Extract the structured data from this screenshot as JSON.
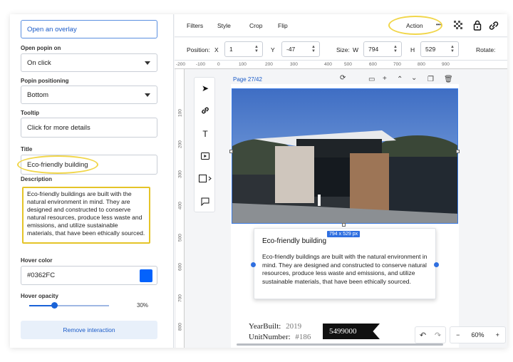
{
  "left_panel": {
    "overlay_button": "Open an overlay",
    "popin_on": {
      "label": "Open popin on",
      "value": "On click"
    },
    "popin_positioning": {
      "label": "Popin positioning",
      "value": "Bottom"
    },
    "tooltip": {
      "label": "Tooltip",
      "value": "Click for more details"
    },
    "title": {
      "label": "Title",
      "value": "Eco-friendly building"
    },
    "description": {
      "label": "Description",
      "value": "Eco-friendly buildings are built with the natural environment in mind. They are designed and constructed to conserve natural resources, produce less waste and emissions, and utilize sustainable materials, that have been ethically sourced."
    },
    "hover_color": {
      "label": "Hover color",
      "value": "#0362FC",
      "swatch": "#0362FC"
    },
    "hover_opacity": {
      "label": "Hover opacity",
      "value": "30%",
      "level": 0.3
    },
    "remove_button": "Remove interaction"
  },
  "toolbar": {
    "filters": "Filters",
    "style": "Style",
    "crop": "Crop",
    "flip": "Flip",
    "action": "Action",
    "more": "•••"
  },
  "props": {
    "position_label": "Position:",
    "x_label": "X",
    "x_value": "1",
    "y_label": "Y",
    "y_value": "-47",
    "size_label": "Size:",
    "w_label": "W",
    "w_value": "794",
    "h_label": "H",
    "h_value": "529",
    "rotate_label": "Rotate:"
  },
  "ruler": {
    "h_ticks": [
      "-200",
      "-100",
      "0",
      "100",
      "200",
      "300",
      "400",
      "500",
      "600",
      "700",
      "800",
      "900"
    ],
    "v_ticks": [
      "100",
      "200",
      "300",
      "400",
      "500",
      "600",
      "700",
      "800",
      "900"
    ]
  },
  "canvas": {
    "page_label": "Page 27/42",
    "size_badge": "794 x 529 px",
    "popup_title": "Eco-friendly building",
    "popup_text": "Eco-friendly buildings are built with the natural environment in mind. They are designed and constructed to conserve natural resources, produce less waste and emissions, and utilize sustainable materials, that have been ethically sourced.",
    "year_label": "YearBuilt:",
    "year_value": "2019",
    "unit_label": "UnitNumber:",
    "unit_value": "#186",
    "price": "5499000"
  },
  "zoom": {
    "minus": "−",
    "value": "60%",
    "plus": "+"
  },
  "colors": {
    "accent": "#1a63d8",
    "highlight": "#f1d64a"
  }
}
